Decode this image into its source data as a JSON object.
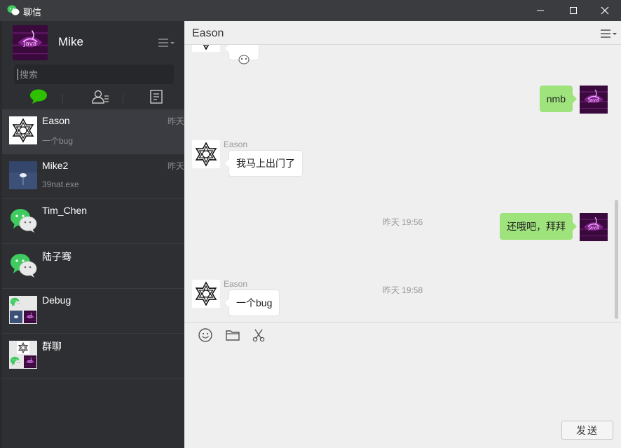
{
  "window": {
    "title": "聊信"
  },
  "profile": {
    "name": "Mike"
  },
  "search": {
    "placeholder": "搜索"
  },
  "chats": [
    {
      "name": "Eason",
      "preview": "一个bug",
      "time": "昨天",
      "avatar": "star-logo",
      "active": true
    },
    {
      "name": "Mike2",
      "preview": "39nat.exe",
      "time": "昨天",
      "avatar": "blue-image"
    },
    {
      "name": "Tim_Chen",
      "preview": "",
      "time": "",
      "avatar": "wechat-logo"
    },
    {
      "name": "陆子骞",
      "preview": "",
      "time": "",
      "avatar": "wechat-logo"
    },
    {
      "name": "Debug",
      "preview": "",
      "time": "",
      "avatar": "group-collage"
    },
    {
      "name": "群聊",
      "preview": "",
      "time": "",
      "avatar": "group-collage-2"
    }
  ],
  "conversation": {
    "title": "Eason",
    "messages": [
      {
        "from": "Mike",
        "text": "nmb"
      },
      {
        "from": "Eason",
        "sender_label": "Eason",
        "text": "我马上出门了"
      },
      {
        "timestamp": "昨天 19:56"
      },
      {
        "from": "Mike",
        "text": "还哦吧，拜拜"
      },
      {
        "timestamp": "昨天 19:58"
      },
      {
        "from": "Eason",
        "sender_label": "Eason",
        "text": "一个bug"
      }
    ]
  },
  "composer": {
    "send_label": "发送"
  },
  "colors": {
    "sidebar_bg": "#2e2f33",
    "accent_green": "#9fe37c",
    "tab_active": "#2dc100",
    "main_bg": "#efefef"
  }
}
